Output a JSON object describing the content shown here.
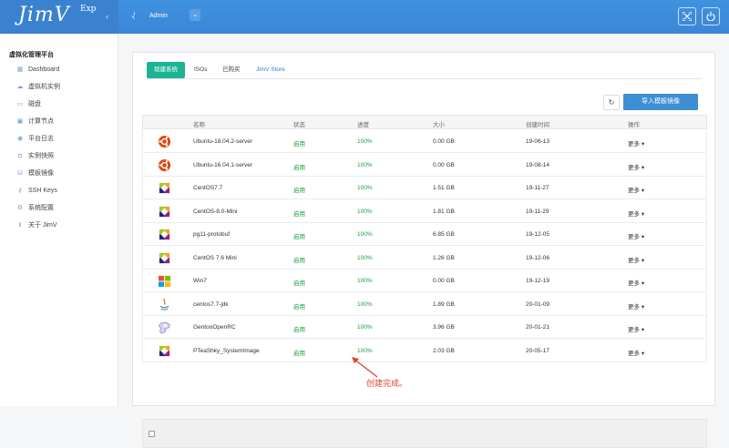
{
  "header": {
    "logo": "JimV",
    "logo_sup": "Exp",
    "collapse": "‹",
    "user": "Admin",
    "user_dropdown": "⌄"
  },
  "sidebar": {
    "title": "虚拟化管理平台",
    "items": [
      {
        "label": "Dashboard",
        "icon": "dashboard-icon"
      },
      {
        "label": "虚拟机实例",
        "icon": "cloud-icon"
      },
      {
        "label": "磁盘",
        "icon": "disk-icon"
      },
      {
        "label": "计算节点",
        "icon": "monitor-icon"
      },
      {
        "label": "平台日志",
        "icon": "eye-icon"
      },
      {
        "label": "实例快照",
        "icon": "camera-icon"
      },
      {
        "label": "模板镜像",
        "icon": "template-icon"
      },
      {
        "label": "SSH Keys",
        "icon": "key-icon"
      },
      {
        "label": "系统配置",
        "icon": "gear-icon"
      },
      {
        "label": "关于 JimV",
        "icon": "info-icon"
      }
    ]
  },
  "tabs": [
    {
      "label": "现建系统",
      "active": true
    },
    {
      "label": "ISOs",
      "active": false
    },
    {
      "label": "已购买",
      "active": false
    },
    {
      "label": "JimV Store",
      "active": false
    }
  ],
  "toolbar": {
    "refresh": "↻",
    "import_label": "导入模板镜像"
  },
  "table": {
    "headers": {
      "name": "名称",
      "state": "状态",
      "progress": "进度",
      "size": "大小",
      "created": "创建时间",
      "action": "操作"
    },
    "rows": [
      {
        "os": "ubuntu",
        "name": "Ubuntu-18.04.2-server",
        "state": "启用",
        "progress": "100%",
        "size": "0.00 GB",
        "created": "19-06-13",
        "action": "更多"
      },
      {
        "os": "ubuntu",
        "name": "Ubuntu-16.04.1-server",
        "state": "启用",
        "progress": "100%",
        "size": "0.00 GB",
        "created": "19-08-14",
        "action": "更多"
      },
      {
        "os": "centos",
        "name": "CentOS7.7",
        "state": "启用",
        "progress": "100%",
        "size": "1.51 GB",
        "created": "19-11-27",
        "action": "更多"
      },
      {
        "os": "centos",
        "name": "CentOS-8.0-Mini",
        "state": "启用",
        "progress": "100%",
        "size": "1.81 GB",
        "created": "19-11-29",
        "action": "更多"
      },
      {
        "os": "centos",
        "name": "pg11-protobuf",
        "state": "启用",
        "progress": "100%",
        "size": "6.85 GB",
        "created": "19-12-05",
        "action": "更多"
      },
      {
        "os": "centos",
        "name": "CentOS 7.6 Mini",
        "state": "启用",
        "progress": "100%",
        "size": "1.26 GB",
        "created": "19-12-06",
        "action": "更多"
      },
      {
        "os": "windows",
        "name": "Win7",
        "state": "启用",
        "progress": "100%",
        "size": "0.00 GB",
        "created": "19-12-19",
        "action": "更多"
      },
      {
        "os": "java",
        "name": "centos7.7-jdk",
        "state": "启用",
        "progress": "100%",
        "size": "1.89 GB",
        "created": "20-01-09",
        "action": "更多"
      },
      {
        "os": "gentoo",
        "name": "GentooOpenRC",
        "state": "启用",
        "progress": "100%",
        "size": "3.96 GB",
        "created": "20-01-21",
        "action": "更多"
      },
      {
        "os": "centos",
        "name": "PTeaShky_SystemImage",
        "state": "启用",
        "progress": "100%",
        "size": "2.03 GB",
        "created": "20-05-17",
        "action": "更多"
      }
    ]
  },
  "annotation": "创建完成。",
  "colors": {
    "header": "#3a86d6",
    "accent": "#1ab394",
    "status_green": "#1a9c3a",
    "annotation_red": "#e4432f"
  }
}
